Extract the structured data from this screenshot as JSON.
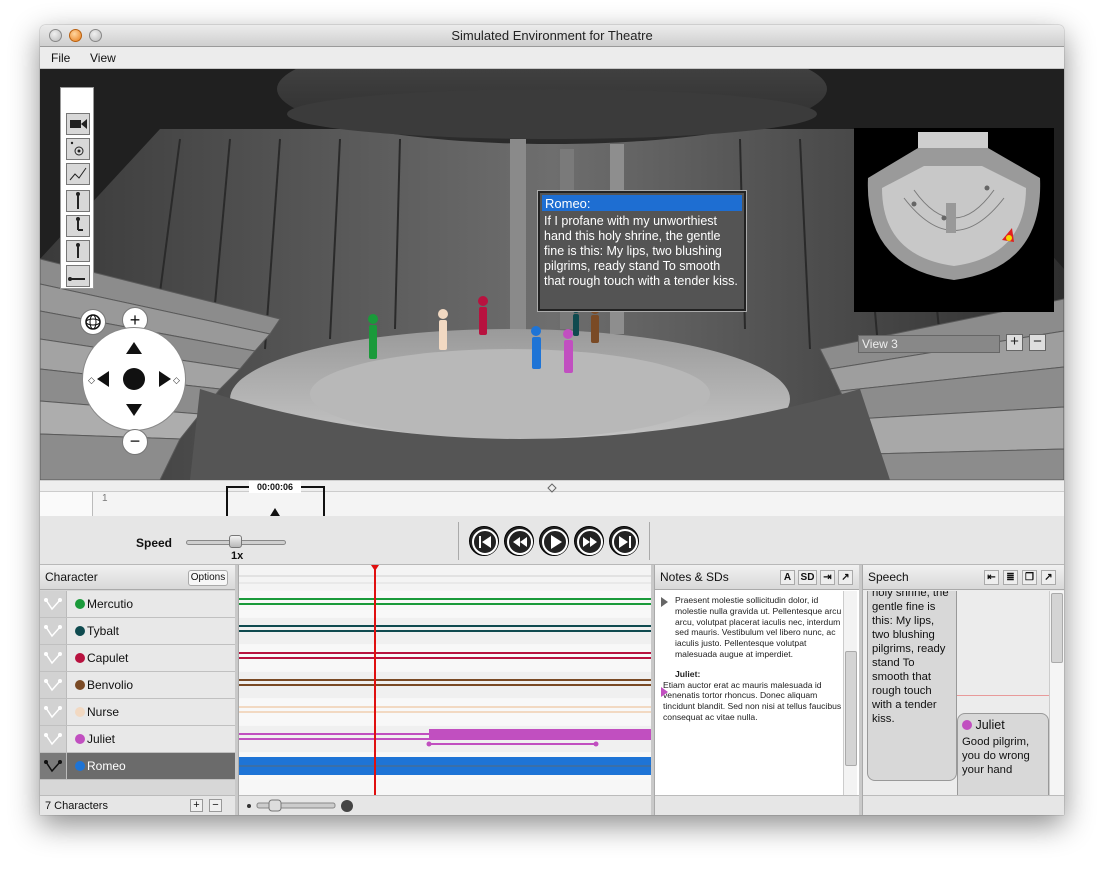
{
  "window": {
    "title": "Simulated Environment for Theatre"
  },
  "menu": {
    "items": [
      "File",
      "View"
    ]
  },
  "viewport": {
    "speech_bubble": {
      "speaker": "Romeo:",
      "text": "If I profane with my unworthiest hand this holy shrine, the gentle fine is this: My lips, two blushing pilgrims, ready stand To smooth that rough touch with a tender kiss."
    },
    "minimap": {
      "view_name": "View 3",
      "add_label": "+",
      "remove_label": "−"
    },
    "nav": {
      "zoom_in": "+",
      "zoom_out": "−"
    }
  },
  "scrubber": {
    "timecode": "00:00:06",
    "frame_label": "1"
  },
  "transport": {
    "speed_label": "Speed",
    "speed_value": "1x",
    "speed_fraction": 0.5,
    "buttons": [
      "skip-to-start-icon",
      "rewind-icon",
      "play-icon",
      "fast-forward-icon",
      "skip-to-end-icon"
    ]
  },
  "characters": {
    "header": "Character",
    "options_label": "Options",
    "footer": "7 Characters",
    "add_label": "+",
    "remove_label": "−",
    "list": [
      {
        "name": "Mercutio",
        "color": "#1a9a3a"
      },
      {
        "name": "Tybalt",
        "color": "#0f4a4f"
      },
      {
        "name": "Capulet",
        "color": "#b8123f"
      },
      {
        "name": "Benvolio",
        "color": "#7a4a25"
      },
      {
        "name": "Nurse",
        "color": "#f2d9c2"
      },
      {
        "name": "Juliet",
        "color": "#c14fc0"
      },
      {
        "name": "Romeo",
        "color": "#1e74d6"
      }
    ],
    "selected": "Romeo"
  },
  "notes": {
    "header": "Notes & SDs",
    "btn_a": "A",
    "btn_sd": "SD",
    "entry1_text": "Praesent molestie sollicitudin dolor, id molestie nulla gravida ut. Pellentesque arcu arcu, volutpat placerat iaculis nec, interdum sed mauris. Vestibulum vel libero nunc, ac iaculis justo. Pellentesque volutpat malesuada augue at imperdiet.",
    "entry2_name": "Juliet:",
    "entry2_text": "Etiam auctor erat ac mauris malesuada id venenatis tortor rhoncus. Donec aliquam tincidunt blandit. Sed non nisi at tellus faucibus consequat ac vitae nulla."
  },
  "speech": {
    "header": "Speech",
    "card1_text": "holy shrine, the gentle fine is this: My lips, two blushing pilgrims, ready stand To smooth that rough touch with a tender kiss.",
    "card2_name": "Juliet",
    "card2_text": "Good pilgrim, you do wrong your hand"
  },
  "colors": {
    "romeo": "#1e74d6",
    "juliet": "#c14fc0",
    "playhead": "#e01010",
    "bubble_header": "#1e6ed2"
  }
}
